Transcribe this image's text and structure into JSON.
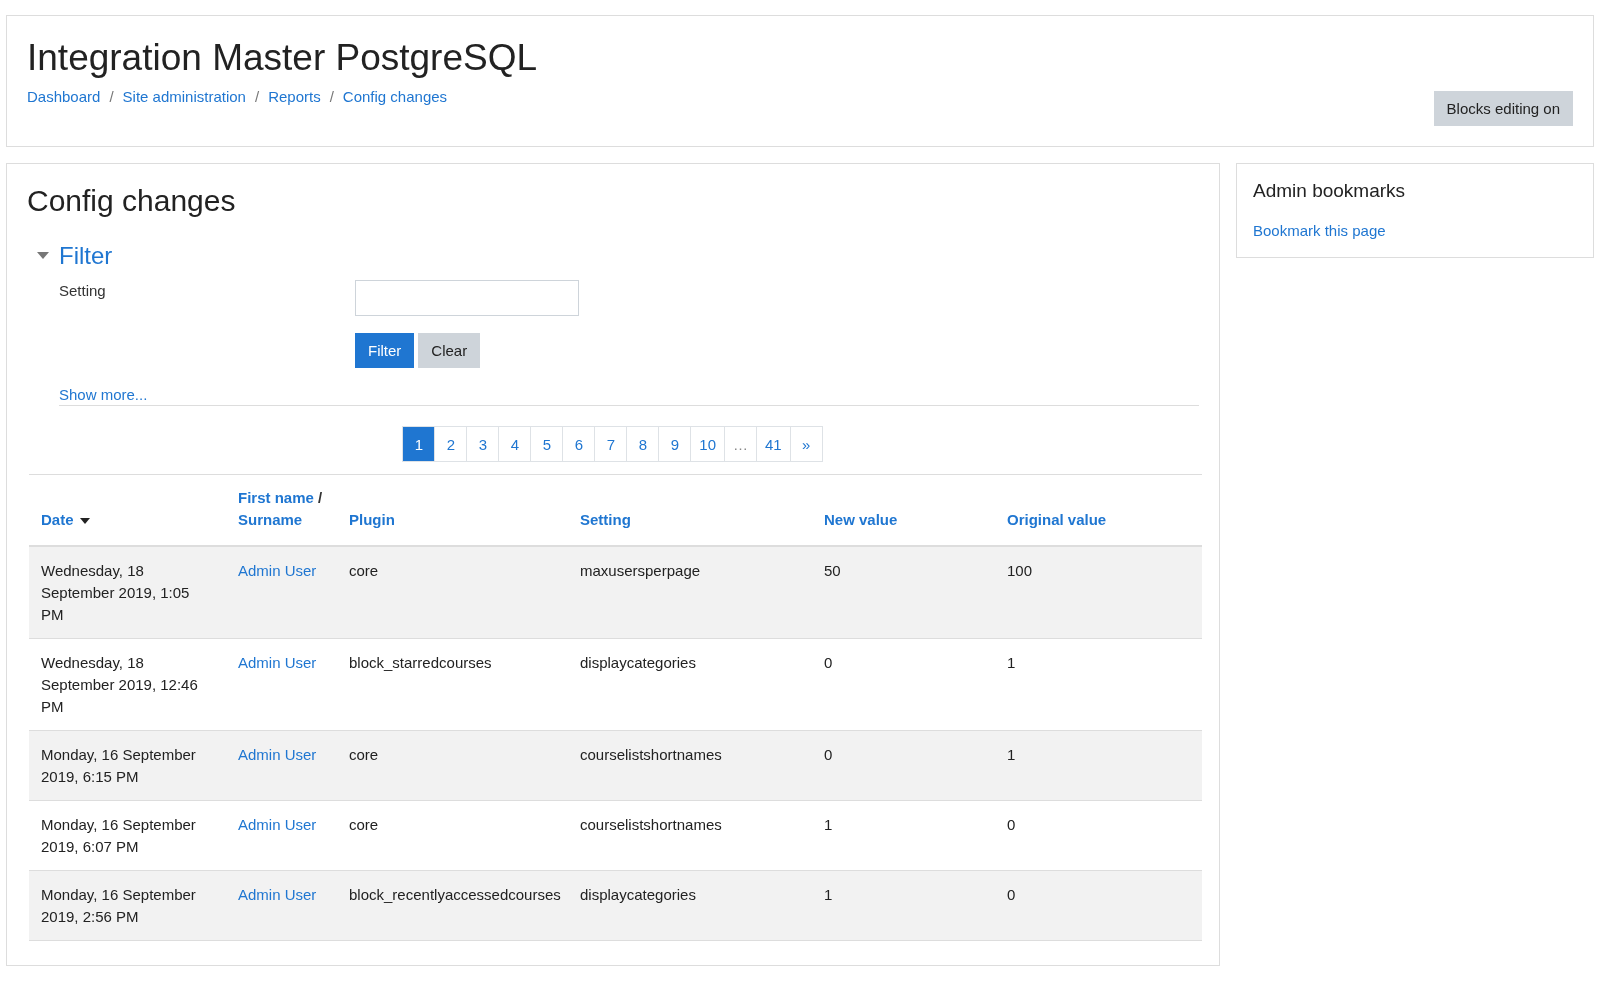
{
  "header": {
    "title": "Integration Master PostgreSQL",
    "breadcrumbs": [
      "Dashboard",
      "Site administration",
      "Reports",
      "Config changes"
    ],
    "breadcrumb_separator": "/",
    "button": "Blocks editing on"
  },
  "main": {
    "heading": "Config changes",
    "filter": {
      "label": "Filter",
      "expanded": true,
      "field": {
        "label": "Setting"
      },
      "buttons": [
        {
          "label": "Filter",
          "kind": "primary"
        },
        {
          "label": "Clear",
          "kind": "secondary"
        }
      ],
      "show_more": "Show more..."
    },
    "pagination": [
      {
        "label": "1",
        "selected": true
      },
      {
        "label": "2",
        "selected": false
      },
      {
        "label": "3",
        "selected": false
      },
      {
        "label": "4",
        "selected": false
      },
      {
        "label": "5",
        "selected": false
      },
      {
        "label": "6",
        "selected": false
      },
      {
        "label": "7",
        "selected": false
      },
      {
        "label": "8",
        "selected": false
      },
      {
        "label": "9",
        "selected": false
      },
      {
        "label": "10",
        "selected": false
      },
      {
        "label": "…",
        "selected": false,
        "disabled": true
      },
      {
        "label": "41",
        "selected": false
      },
      {
        "label": "»",
        "selected": false
      }
    ],
    "table": {
      "columns": [
        {
          "label": "Date",
          "sorted": true
        },
        {
          "links": [
            "First name",
            "Surname"
          ],
          "separator": "/",
          "sorted": false
        },
        {
          "label": "Plugin",
          "sorted": false
        },
        {
          "label": "Setting",
          "sorted": false
        },
        {
          "label": "New value",
          "sorted": false
        },
        {
          "label": "Original value",
          "sorted": false
        }
      ],
      "rows": [
        {
          "date": "Wednesday, 18 September 2019, 1:05 PM",
          "user": "Admin User",
          "plugin": "core",
          "setting": "maxusersperpage",
          "new_value": "50",
          "original_value": "100"
        },
        {
          "date": "Wednesday, 18 September 2019, 12:46 PM",
          "user": "Admin User",
          "plugin": "block_starredcourses",
          "setting": "displaycategories",
          "new_value": "0",
          "original_value": "1"
        },
        {
          "date": "Monday, 16 September 2019, 6:15 PM",
          "user": "Admin User",
          "plugin": "core",
          "setting": "courselistshortnames",
          "new_value": "0",
          "original_value": "1"
        },
        {
          "date": "Monday, 16 September 2019, 6:07 PM",
          "user": "Admin User",
          "plugin": "core",
          "setting": "courselistshortnames",
          "new_value": "1",
          "original_value": "0"
        },
        {
          "date": "Monday, 16 September 2019, 2:56 PM",
          "user": "Admin User",
          "plugin": "block_recentlyaccessedcourses",
          "setting": "displaycategories",
          "new_value": "1",
          "original_value": "0"
        }
      ]
    }
  },
  "sidebar": {
    "title": "Admin bookmarks",
    "link": "Bookmark this page"
  }
}
